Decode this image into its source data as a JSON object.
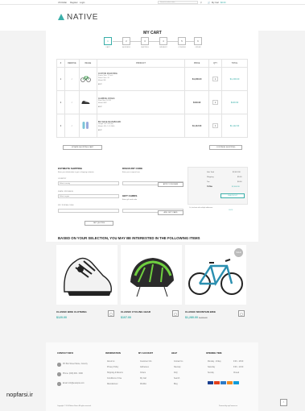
{
  "topbar": {
    "language": "US Dollar",
    "register": "Register",
    "login": "Login",
    "search_placeholder": "Search entire store",
    "cart_text": "My Cart",
    "cart_total": "$0.00"
  },
  "header": {
    "logo": "NATIVE",
    "nav": [
      "HOME PAGE",
      "PRODUCTS",
      "MANUFACTURERS",
      "MY ACCOUNT",
      "CONTACT US",
      "BLOG"
    ]
  },
  "page_title": "MY CART",
  "steps": [
    {
      "num": "1",
      "label": "CART"
    },
    {
      "num": "2",
      "label": "ADDRESS"
    },
    {
      "num": "3",
      "label": "SHIPPING"
    },
    {
      "num": "4",
      "label": "PAYMENT"
    },
    {
      "num": "5",
      "label": "CONFIRM"
    },
    {
      "num": "6",
      "label": "ORDER"
    }
  ],
  "cart_table": {
    "headers": [
      "#",
      "REMOVE",
      "IMAGE",
      "PRODUCT",
      "PRICE",
      "QTY",
      "TOTAL"
    ],
    "rows": [
      {
        "num": "1",
        "name": "CUSTOM ROAD BIKE",
        "meta1": "Frame Size: 17 inch",
        "meta2": "Wheel Size: 26",
        "meta3": "Model: BB",
        "edit": "EDIT",
        "price": "$1,200.00",
        "qty": "1",
        "total": "$1,200.00"
      },
      {
        "num": "2",
        "name": "CLIMBING SHOES",
        "meta1": "Shoe Size: EU 41",
        "meta2": "Model: BB2",
        "meta3": "",
        "edit": "EDIT",
        "price": "$149.90",
        "qty": "1",
        "total": "$149.90"
      },
      {
        "num": "3",
        "name": "BIG WAVE SKATEBOARD",
        "meta1": "Length: 44 / 100 (M)",
        "meta2": "Model: 48 LC 4.5 M40",
        "meta3": "",
        "edit": "EDIT",
        "price": "$1,112.00",
        "qty": "1",
        "total": "$1,112.00"
      }
    ]
  },
  "buttons": {
    "update_cart": "UPDATE SHOPPING CART",
    "continue": "CONTINUE SHOPPING",
    "apply_voucher": "APPLY VOUCHER",
    "add_gift_card": "ADD GIFT CARD",
    "get_quotes": "GET QUOTES",
    "checkout": "CHECKOUT"
  },
  "shipping": {
    "title": "ESTIMATE SHIPPING",
    "desc": "Enter your destination to get a shipping estimate.",
    "country_label": "COUNTRY",
    "country_value": "Select country",
    "region_label": "STATE / PROVINCE",
    "region_value": "Select region",
    "zip_label": "ZIP / POSTAL CODE"
  },
  "discount": {
    "title": "DISCOUNT CODE",
    "desc": "Enter your coupon here",
    "gift_title": "GIFT CARDS",
    "gift_desc": "Enter gift card code"
  },
  "totals": {
    "rows": [
      {
        "label": "Sub Total",
        "value": "$2,461.90"
      },
      {
        "label": "Shipping",
        "value": "$5.00"
      },
      {
        "label": "Tax",
        "value": "$0.00"
      }
    ],
    "total_label": "TOTAL",
    "total_value": "$2,466.90",
    "note": "Or, checkout with multiple addresses",
    "note_link": "CLICK"
  },
  "related": {
    "title": "BASED ON YOUR SELECTION, YOU MAY BE INTERESTED IN THE FOLLOWING ITEMS",
    "items": [
      {
        "name": "CLASSIC BIKE CLOTHING",
        "price": "$120.00",
        "old": ""
      },
      {
        "name": "CLASSIC CYCLING GEAR",
        "price": "$107.00",
        "old": ""
      },
      {
        "name": "CLASSIC MOUNTAIN BIKE",
        "price": "$1,280.00",
        "old": "$1,500.00"
      }
    ],
    "sale_badge": "SALE"
  },
  "footer": {
    "contact_title": "CONTACT INFO",
    "contact_lines": [
      "PO Box Street Name, Country",
      "Phone: (000) 000 - 0000",
      "Email: info@example.com"
    ],
    "info_title": "INFORMATION",
    "info_links": [
      "About Us",
      "Privacy Policy",
      "Shipping & Returns",
      "Conditions of Use",
      "Manufacturer"
    ],
    "account_title": "MY ACCOUNT",
    "account_links": [
      "Customer Info",
      "Addresses",
      "Orders",
      "My Cart",
      "Wishlist"
    ],
    "help_title": "HELP",
    "help_links": [
      "Contact Us",
      "Sitemap",
      "FAQ",
      "Search",
      "Blog"
    ],
    "hours_title": "OPENING TIME",
    "hours": [
      {
        "day": "Monday - Friday",
        "time": "9:00 - 18:00"
      },
      {
        "day": "Saturday",
        "time": "9:00 - 14:00"
      },
      {
        "day": "Sunday",
        "time": "Closed"
      }
    ],
    "copyright": "Copyright © 2014 Native Store. All rights reserved.",
    "powered": "Powered by nopCommerce"
  },
  "watermark": "nopfarsi.ir",
  "colors": {
    "accent": "#3aafa9"
  }
}
